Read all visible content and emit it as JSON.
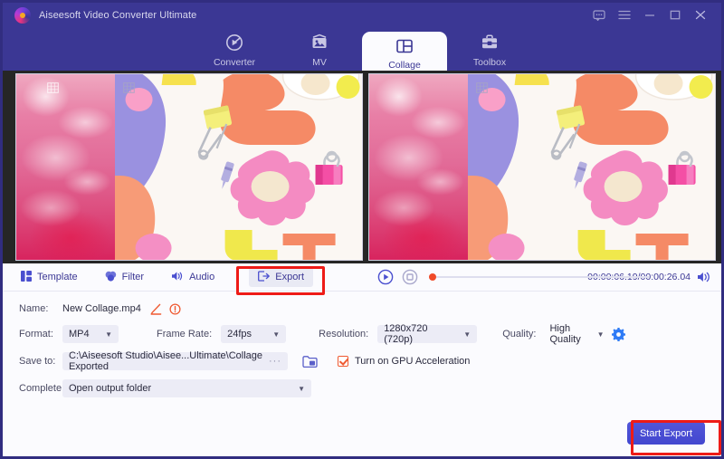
{
  "window": {
    "title": "Aiseesoft Video Converter Ultimate",
    "logo_icon": "aiseesoft-logo-icon",
    "controls": [
      {
        "name": "feedback-icon",
        "label": "Feedback"
      },
      {
        "name": "menu-icon",
        "label": "Menu"
      },
      {
        "name": "minimize-icon",
        "label": "Minimize"
      },
      {
        "name": "maximize-icon",
        "label": "Maximize"
      },
      {
        "name": "close-icon",
        "label": "Close"
      }
    ]
  },
  "nav": {
    "tabs": [
      {
        "label": "Converter",
        "icon": "converter-icon",
        "active": false
      },
      {
        "label": "MV",
        "icon": "mv-icon",
        "active": false
      },
      {
        "label": "Collage",
        "icon": "collage-icon",
        "active": true
      },
      {
        "label": "Toolbox",
        "icon": "toolbox-icon",
        "active": false
      }
    ]
  },
  "preview": {
    "left_pane_label": "collage-preview-left",
    "right_pane_label": "collage-preview-right",
    "crop_icon": "crop-grid-icon"
  },
  "toolbar": {
    "tabs": [
      {
        "label": "Template",
        "icon": "template-icon",
        "selected": false
      },
      {
        "label": "Filter",
        "icon": "filter-icon",
        "selected": false
      },
      {
        "label": "Audio",
        "icon": "audio-icon",
        "selected": false
      },
      {
        "label": "Export",
        "icon": "export-icon",
        "selected": true
      }
    ]
  },
  "player": {
    "play_icon": "play-icon",
    "stop_icon": "stop-icon",
    "playhead_icon": "playhead-dot",
    "time": "00:00:06.19/00:00:26.04",
    "volume_icon": "volume-icon"
  },
  "export": {
    "name_label": "Name:",
    "name_value": "New Collage.mp4",
    "edit_icon": "edit-pencil-icon",
    "info_icon": "info-icon",
    "format_label": "Format:",
    "format_value": "MP4",
    "framerate_label": "Frame Rate:",
    "framerate_value": "24fps",
    "resolution_label": "Resolution:",
    "resolution_value": "1280x720 (720p)",
    "quality_label": "Quality:",
    "quality_value": "High Quality",
    "settings_icon": "gear-icon",
    "saveto_label": "Save to:",
    "saveto_value": "C:\\Aiseesoft Studio\\Aisee...Ultimate\\Collage Exported",
    "browse_ellipsis": "···",
    "folder_icon": "folder-icon",
    "gpu_label": "Turn on GPU Acceleration",
    "gpu_checked": true,
    "complete_label": "Complete:",
    "complete_value": "Open output folder",
    "start_button": "Start Export"
  },
  "colors": {
    "brand_purple": "#3b3794",
    "accent_blue": "#4a4fcf",
    "annotation_red": "#ee1b17",
    "accent_orange": "#ef5a32",
    "panel_bg": "#fbfbfe",
    "field_bg": "#ececf6"
  }
}
